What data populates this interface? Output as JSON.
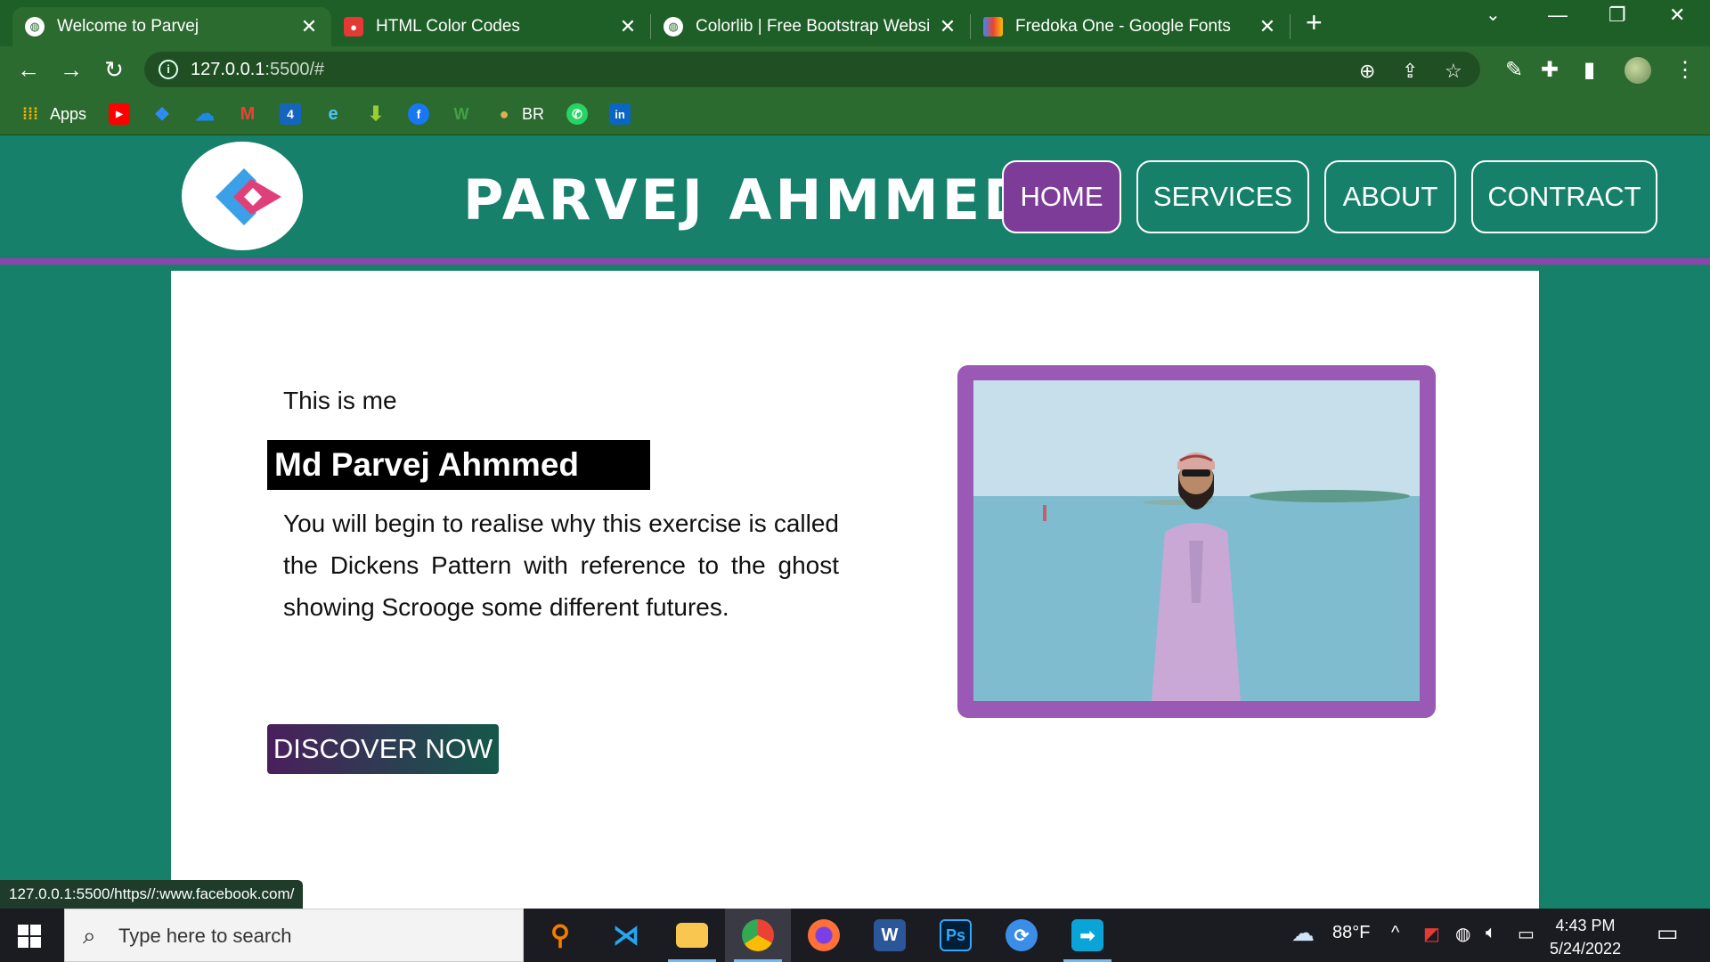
{
  "browser": {
    "tabs": [
      {
        "title": "Welcome to Parvej",
        "active": true
      },
      {
        "title": "HTML Color Codes",
        "active": false
      },
      {
        "title": "Colorlib | Free Bootstrap Website",
        "active": false
      },
      {
        "title": "Fredoka One - Google Fonts",
        "active": false
      }
    ],
    "url_host": "127.0.0.1",
    "url_path": ":5500/#",
    "bookmarks": {
      "apps_label": "Apps",
      "br_label": "BR"
    }
  },
  "site": {
    "title": "PARVEJ AHMMED",
    "nav": [
      "HOME",
      "SERVICES",
      "ABOUT",
      "CONTRACT"
    ],
    "active_nav": "HOME",
    "intro": "This is me",
    "name": "Md Parvej Ahmmed",
    "description": "You will begin to realise why this exercise is called the Dickens Pattern with reference to the ghost showing Scrooge some different futures.",
    "cta": "DISCOVER NOW",
    "colors": {
      "primary": "#16806a",
      "accent": "#8e44ad",
      "nav_active": "#7d3c98"
    }
  },
  "status_bar_url": "127.0.0.1:5500/https//:www.facebook.com/",
  "taskbar": {
    "search_placeholder": "Type here to search",
    "weather": "88°F",
    "time": "4:43 PM",
    "date": "5/24/2022"
  }
}
